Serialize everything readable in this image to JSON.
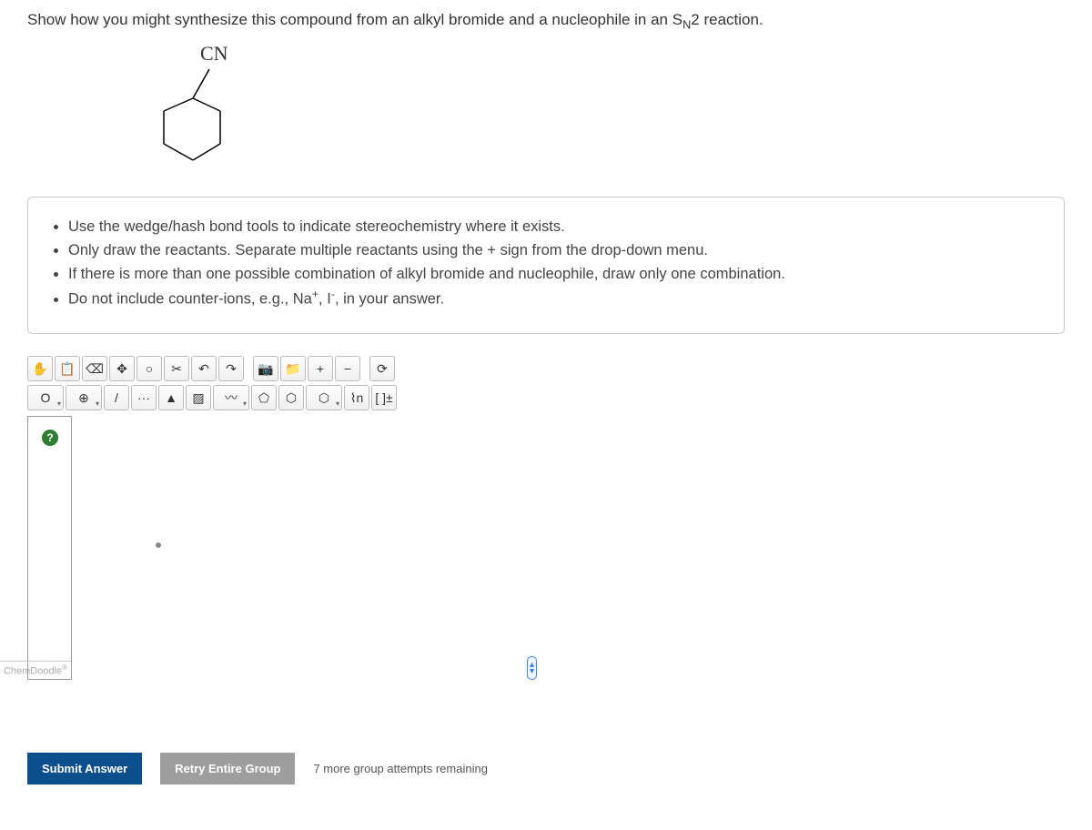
{
  "question": {
    "prompt_pre": "Show how you might synthesize this compound from an alkyl bromide and a nucleophile in an S",
    "prompt_sub": "N",
    "prompt_post": "2 reaction.",
    "cn_label": "CN"
  },
  "instructions": {
    "items": [
      "Use the wedge/hash bond tools to indicate stereochemistry where it exists.",
      "Only draw the reactants. Separate multiple reactants using the + sign from the drop-down menu.",
      "If there is more than one possible combination of alkyl bromide and nucleophile, draw only one combination."
    ],
    "last_pre": "Do not include counter-ions, e.g., Na",
    "last_sup1": "+",
    "last_mid": ", I",
    "last_sup2": "-",
    "last_post": ", in your answer."
  },
  "toolbar": {
    "row1": {
      "hand": "✋",
      "paste": "📋",
      "eraser": "⌫",
      "move": "✥",
      "lasso": "○",
      "scissors": "✂",
      "undo": "↶",
      "redo": "↷",
      "camera": "📷",
      "folder": "📁",
      "zoom_in": "+",
      "zoom_out": "−",
      "clean": "⟳"
    },
    "row2": {
      "element_o": "O",
      "plus_dd": "⊕",
      "bond_single": "/",
      "bond_dot": "···",
      "bond_wedge": "▲",
      "bond_hash": "▨",
      "bond_wavy": "〰",
      "ring1": "⬠",
      "ring2": "⬡",
      "ring3": "⬡",
      "chain": "⌇n",
      "charge": "[ ]±"
    }
  },
  "canvas": {
    "help": "?",
    "brand": "ChemDoodle"
  },
  "actions": {
    "submit": "Submit Answer",
    "retry": "Retry Entire Group",
    "attempts": "7 more group attempts remaining"
  }
}
